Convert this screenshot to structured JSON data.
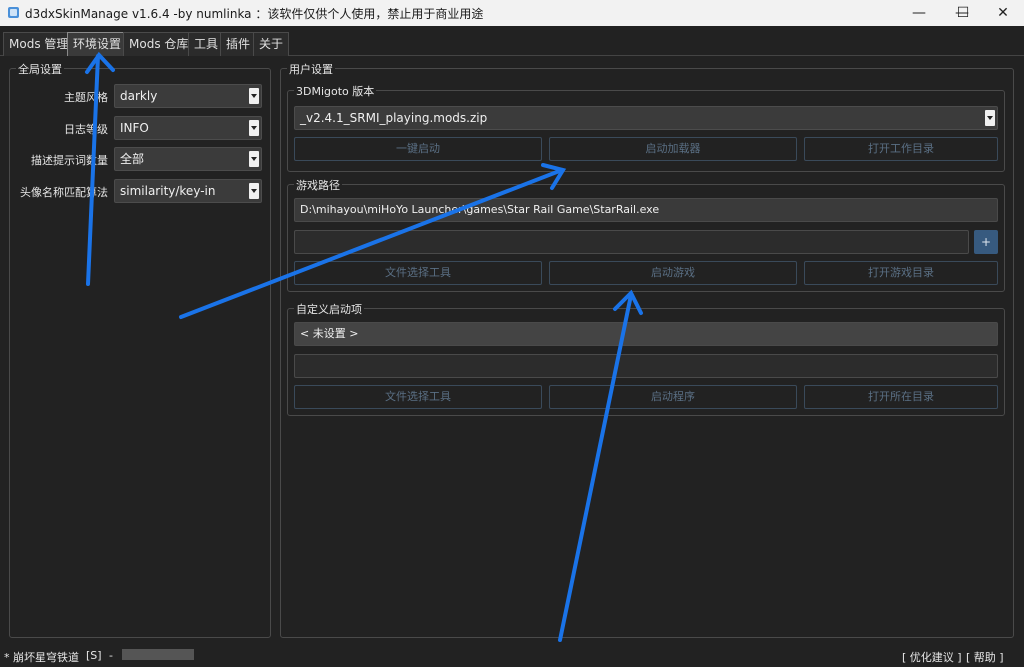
{
  "window": {
    "title": "d3dxSkinManage v1.6.4 -by numlinka ：该软件仅供个人使用，禁止用于商业用途",
    "app_icon": "app-icon",
    "minimize_glyph": "—",
    "maximize_glyph": "☐",
    "close_glyph": "✕"
  },
  "tabs": [
    {
      "label": "Mods 管理"
    },
    {
      "label": "环境设置",
      "active": true
    },
    {
      "label": "Mods 仓库"
    },
    {
      "label": "工具"
    },
    {
      "label": "插件"
    },
    {
      "label": "关于"
    }
  ],
  "global_settings": {
    "title": "全局设置",
    "theme": {
      "label": "主题风格",
      "value": "darkly"
    },
    "log_level": {
      "label": "日志等级",
      "value": "INFO"
    },
    "hint_count": {
      "label": "描述提示词数量",
      "value": "全部"
    },
    "avatar_match": {
      "label": "头像名称匹配算法",
      "value": "similarity/key-in"
    }
  },
  "user_settings": {
    "title": "用户设置",
    "migoto": {
      "title": "3DMigoto 版本",
      "version": "_v2.4.1_SRMI_playing.mods.zip",
      "buttons": [
        "一键启动",
        "启动加载器",
        "打开工作目录"
      ]
    },
    "game_path": {
      "title": "游戏路径",
      "path": "D:\\mihayou\\miHoYo Launcher\\games\\Star Rail Game\\StarRail.exe",
      "args": "",
      "plus_label": "+",
      "buttons": [
        "文件选择工具",
        "启动游戏",
        "打开游戏目录"
      ]
    },
    "custom_launch": {
      "title": "自定义启动项",
      "value": "< 未设置 >",
      "args": "",
      "buttons": [
        "文件选择工具",
        "启动程序",
        "打开所在目录"
      ]
    }
  },
  "status": {
    "game": "* 崩坏星穹铁道",
    "flag": "[S]",
    "sep": "-",
    "progress": 0,
    "suggest": "[ 优化建议 ]",
    "help": "[ 帮助 ]"
  },
  "colors": {
    "background": "#222222",
    "accent": "#375a7f",
    "annotation_arrow": "#1a73e8"
  }
}
